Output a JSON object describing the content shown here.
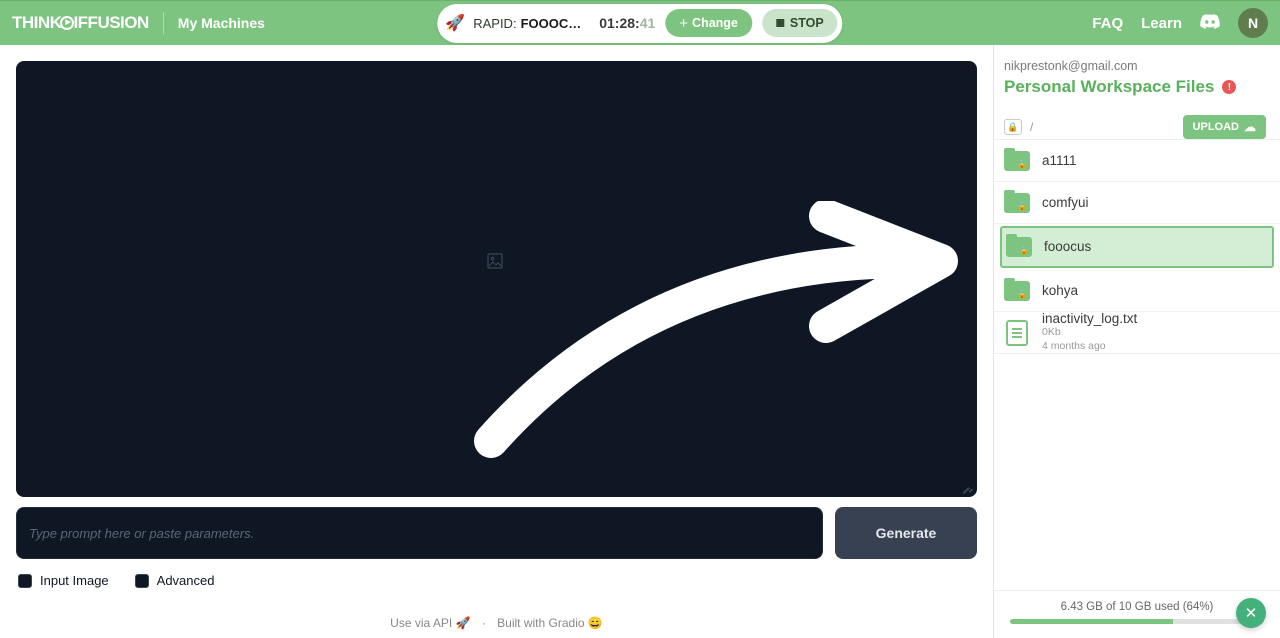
{
  "header": {
    "logo_pre": "THINK",
    "logo_post": "IFFUSION",
    "my_machines": "My Machines",
    "rapid_label": "RAPID:",
    "app_name": "FOOOC…",
    "timer_main": "01:28:",
    "timer_faded": "41",
    "change": "Change",
    "stop": "STOP",
    "faq": "FAQ",
    "learn": "Learn",
    "avatar": "N"
  },
  "main": {
    "prompt_placeholder": "Type prompt here or paste parameters.",
    "generate": "Generate",
    "input_image": "Input Image",
    "advanced": "Advanced",
    "api": "Use via API",
    "api_emoji": "🚀",
    "dot": "·",
    "built": "Built with Gradio",
    "gradio_emoji": "😄"
  },
  "side": {
    "email": "nikprestonk@gmail.com",
    "title": "Personal Workspace Files",
    "path": "/",
    "upload": "UPLOAD",
    "folders": [
      "a1111",
      "comfyui",
      "fooocus",
      "kohya"
    ],
    "file_name": "inactivity_log.txt",
    "file_size": "0Kb",
    "file_age": "4 months ago",
    "storage": "6.43 GB of 10 GB used (64%)"
  }
}
